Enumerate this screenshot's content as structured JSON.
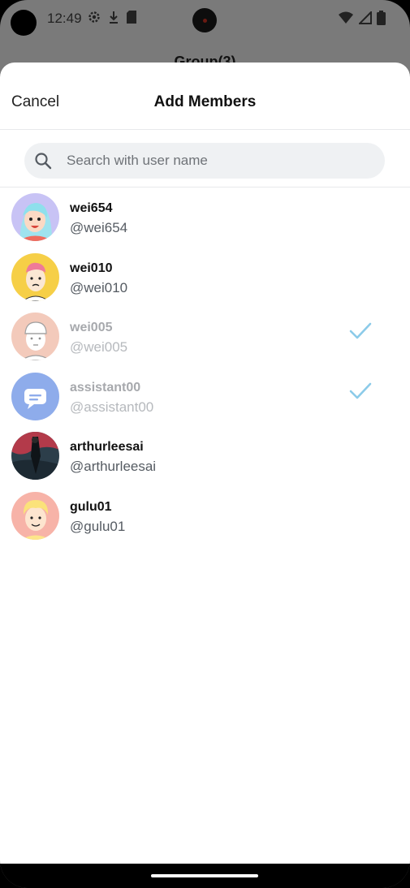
{
  "status_bar": {
    "time": "12:49",
    "icons_left": [
      "settings-gear-icon",
      "download-icon",
      "sd-card-icon"
    ],
    "icons_right": [
      "wifi-icon",
      "cell-signal-icon",
      "battery-icon"
    ]
  },
  "behind": {
    "back_icon": "arrow-left-icon",
    "title": "Group(3)"
  },
  "sheet": {
    "cancel_label": "Cancel",
    "title": "Add Members",
    "search": {
      "placeholder": "Search with user name",
      "value": "",
      "icon": "search-icon"
    },
    "users": [
      {
        "name": "wei654",
        "handle": "@wei654",
        "selected": false,
        "disabled": false
      },
      {
        "name": "wei010",
        "handle": "@wei010",
        "selected": false,
        "disabled": false
      },
      {
        "name": "wei005",
        "handle": "@wei005",
        "selected": true,
        "disabled": true
      },
      {
        "name": "assistant00",
        "handle": "@assistant00",
        "selected": true,
        "disabled": true
      },
      {
        "name": "arthurleesai",
        "handle": "@arthurleesai",
        "selected": false,
        "disabled": false
      },
      {
        "name": "gulu01",
        "handle": "@gulu01",
        "selected": false,
        "disabled": false
      }
    ]
  },
  "colors": {
    "check": "#8ccbe9",
    "search_bg": "#eff1f3",
    "overlay": "#7a7a7a"
  }
}
